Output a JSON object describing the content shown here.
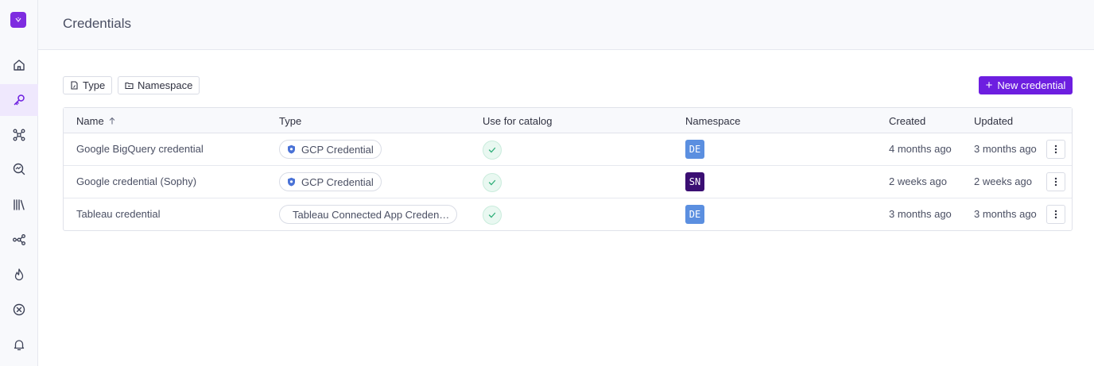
{
  "page": {
    "title": "Credentials"
  },
  "sidebar": {
    "items": [
      {
        "name": "home-icon",
        "active": false
      },
      {
        "name": "key-icon",
        "active": true
      },
      {
        "name": "graph-icon",
        "active": false
      },
      {
        "name": "search-insight-icon",
        "active": false
      },
      {
        "name": "library-icon",
        "active": false
      },
      {
        "name": "lineage-icon",
        "active": false
      },
      {
        "name": "flame-icon",
        "active": false
      },
      {
        "name": "close-circle-icon",
        "active": false
      },
      {
        "name": "bell-icon",
        "active": false
      }
    ]
  },
  "filters": {
    "type_label": "Type",
    "namespace_label": "Namespace"
  },
  "actions": {
    "new_credential_label": "New credential"
  },
  "table": {
    "columns": {
      "name": "Name",
      "type": "Type",
      "use_for_catalog": "Use for catalog",
      "namespace": "Namespace",
      "created": "Created",
      "updated": "Updated"
    },
    "rows": [
      {
        "name": "Google BigQuery credential",
        "type": "GCP Credential",
        "type_icon": "gcp-shield-icon",
        "use_for_catalog": true,
        "namespace": "DE",
        "namespace_color": "#5b8fe0",
        "created": "4 months ago",
        "updated": "3 months ago"
      },
      {
        "name": "Google credential (Sophy)",
        "type": "GCP Credential",
        "type_icon": "gcp-shield-icon",
        "use_for_catalog": true,
        "namespace": "SN",
        "namespace_color": "#3b0f73",
        "created": "2 weeks ago",
        "updated": "2 weeks ago"
      },
      {
        "name": "Tableau credential",
        "type": "Tableau Connected App Creden…",
        "type_icon": "tableau-icon",
        "use_for_catalog": true,
        "namespace": "DE",
        "namespace_color": "#5b8fe0",
        "created": "3 months ago",
        "updated": "3 months ago"
      }
    ]
  },
  "colors": {
    "accent": "#6d1ee0",
    "logo": "#7e2ce0",
    "check": "#2fae79"
  }
}
